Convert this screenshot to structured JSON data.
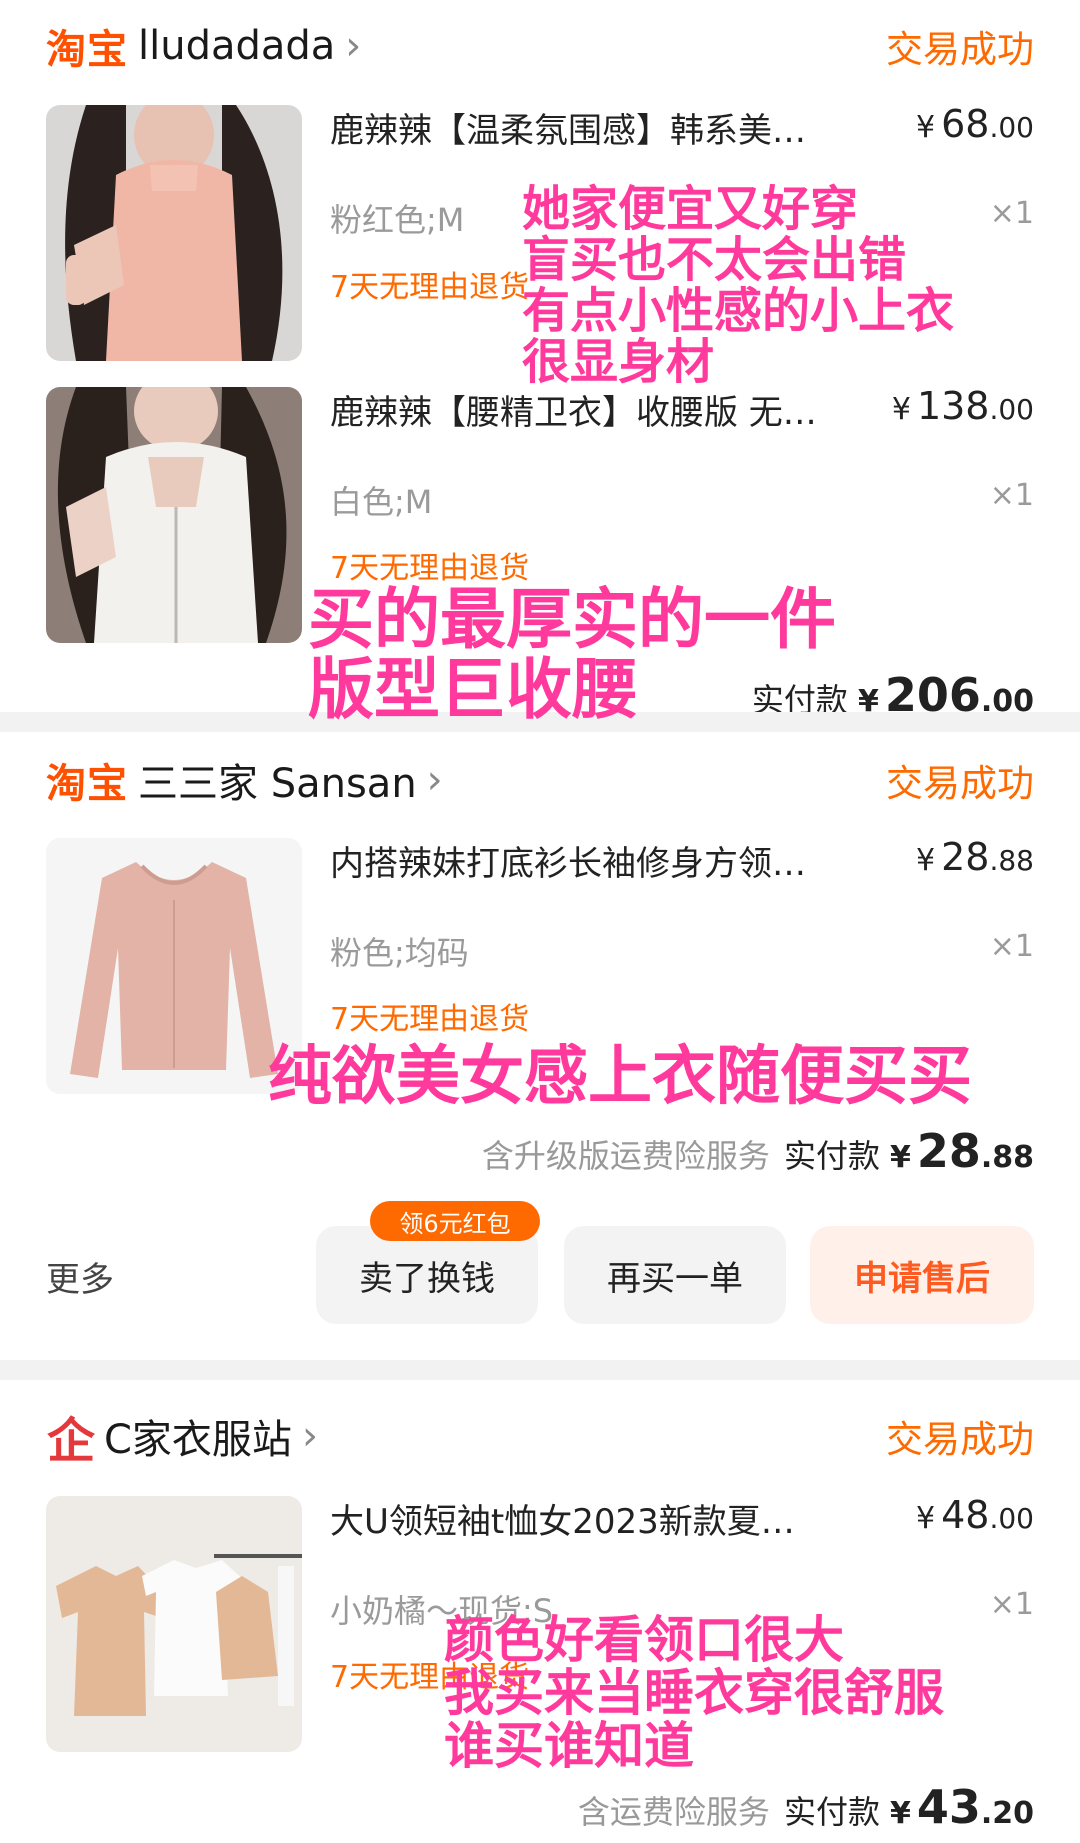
{
  "colors": {
    "brand": "#ff5000",
    "status": "#ff6a00",
    "overlay_text": "#ff3a9c",
    "qi_brand": "#e4393c"
  },
  "orders": [
    {
      "brand": "淘宝",
      "store": "lludadada",
      "status": "交易成功",
      "items": [
        {
          "title": "鹿辣辣【温柔氛围感】韩系美…",
          "yen": "¥",
          "price_int": "68",
          "price_cents": ".00",
          "sku": "粉红色;M",
          "qty": "×1",
          "policy": "7天无理由退货"
        },
        {
          "title": "鹿辣辣【腰精卫衣】收腰版 无…",
          "yen": "¥",
          "price_int": "138",
          "price_cents": ".00",
          "sku": "白色;M",
          "qty": "×1",
          "policy": "7天无理由退货"
        }
      ],
      "paid_label": "实付款",
      "paid_yen": "¥",
      "paid_int": "206",
      "paid_cents": ".00"
    },
    {
      "brand": "淘宝",
      "store": "三三家 Sansan",
      "status": "交易成功",
      "items": [
        {
          "title": "内搭辣妹打底衫长袖修身方领…",
          "yen": "¥",
          "price_int": "28",
          "price_cents": ".88",
          "sku": "粉色;均码",
          "qty": "×1",
          "policy": "7天无理由退货"
        }
      ],
      "service": "含升级版运费险服务",
      "paid_label": "实付款",
      "paid_yen": "¥",
      "paid_int": "28",
      "paid_cents": ".88",
      "actions": {
        "more": "更多",
        "sell": "卖了换钱",
        "sell_badge": "领6元红包",
        "rebuy": "再买一单",
        "after_sale": "申请售后"
      }
    },
    {
      "brand_icon": "qi-icon",
      "brand": "企",
      "store": "C家衣服站",
      "status": "交易成功",
      "items": [
        {
          "title": "大U领短袖t恤女2023新款夏…",
          "yen": "¥",
          "price_int": "48",
          "price_cents": ".00",
          "sku": "小奶橘～现货;S",
          "qty": "×1",
          "policy": "7天无理由退货"
        }
      ],
      "service": "含运费险服务",
      "paid_label": "实付款",
      "paid_yen": "¥",
      "paid_int": "43",
      "paid_cents": ".20"
    }
  ],
  "annotations": {
    "a1": [
      "她家便宜又好穿",
      "盲买也不太会出错",
      "有点小性感的小上衣",
      "很显身材"
    ],
    "a2": [
      "买的最厚实的一件",
      "版型巨收腰"
    ],
    "a3": [
      "纯欲美女感上衣随便买买"
    ],
    "a4": [
      "颜色好看领口很大",
      "我买来当睡衣穿很舒服",
      "谁买谁知道"
    ]
  }
}
